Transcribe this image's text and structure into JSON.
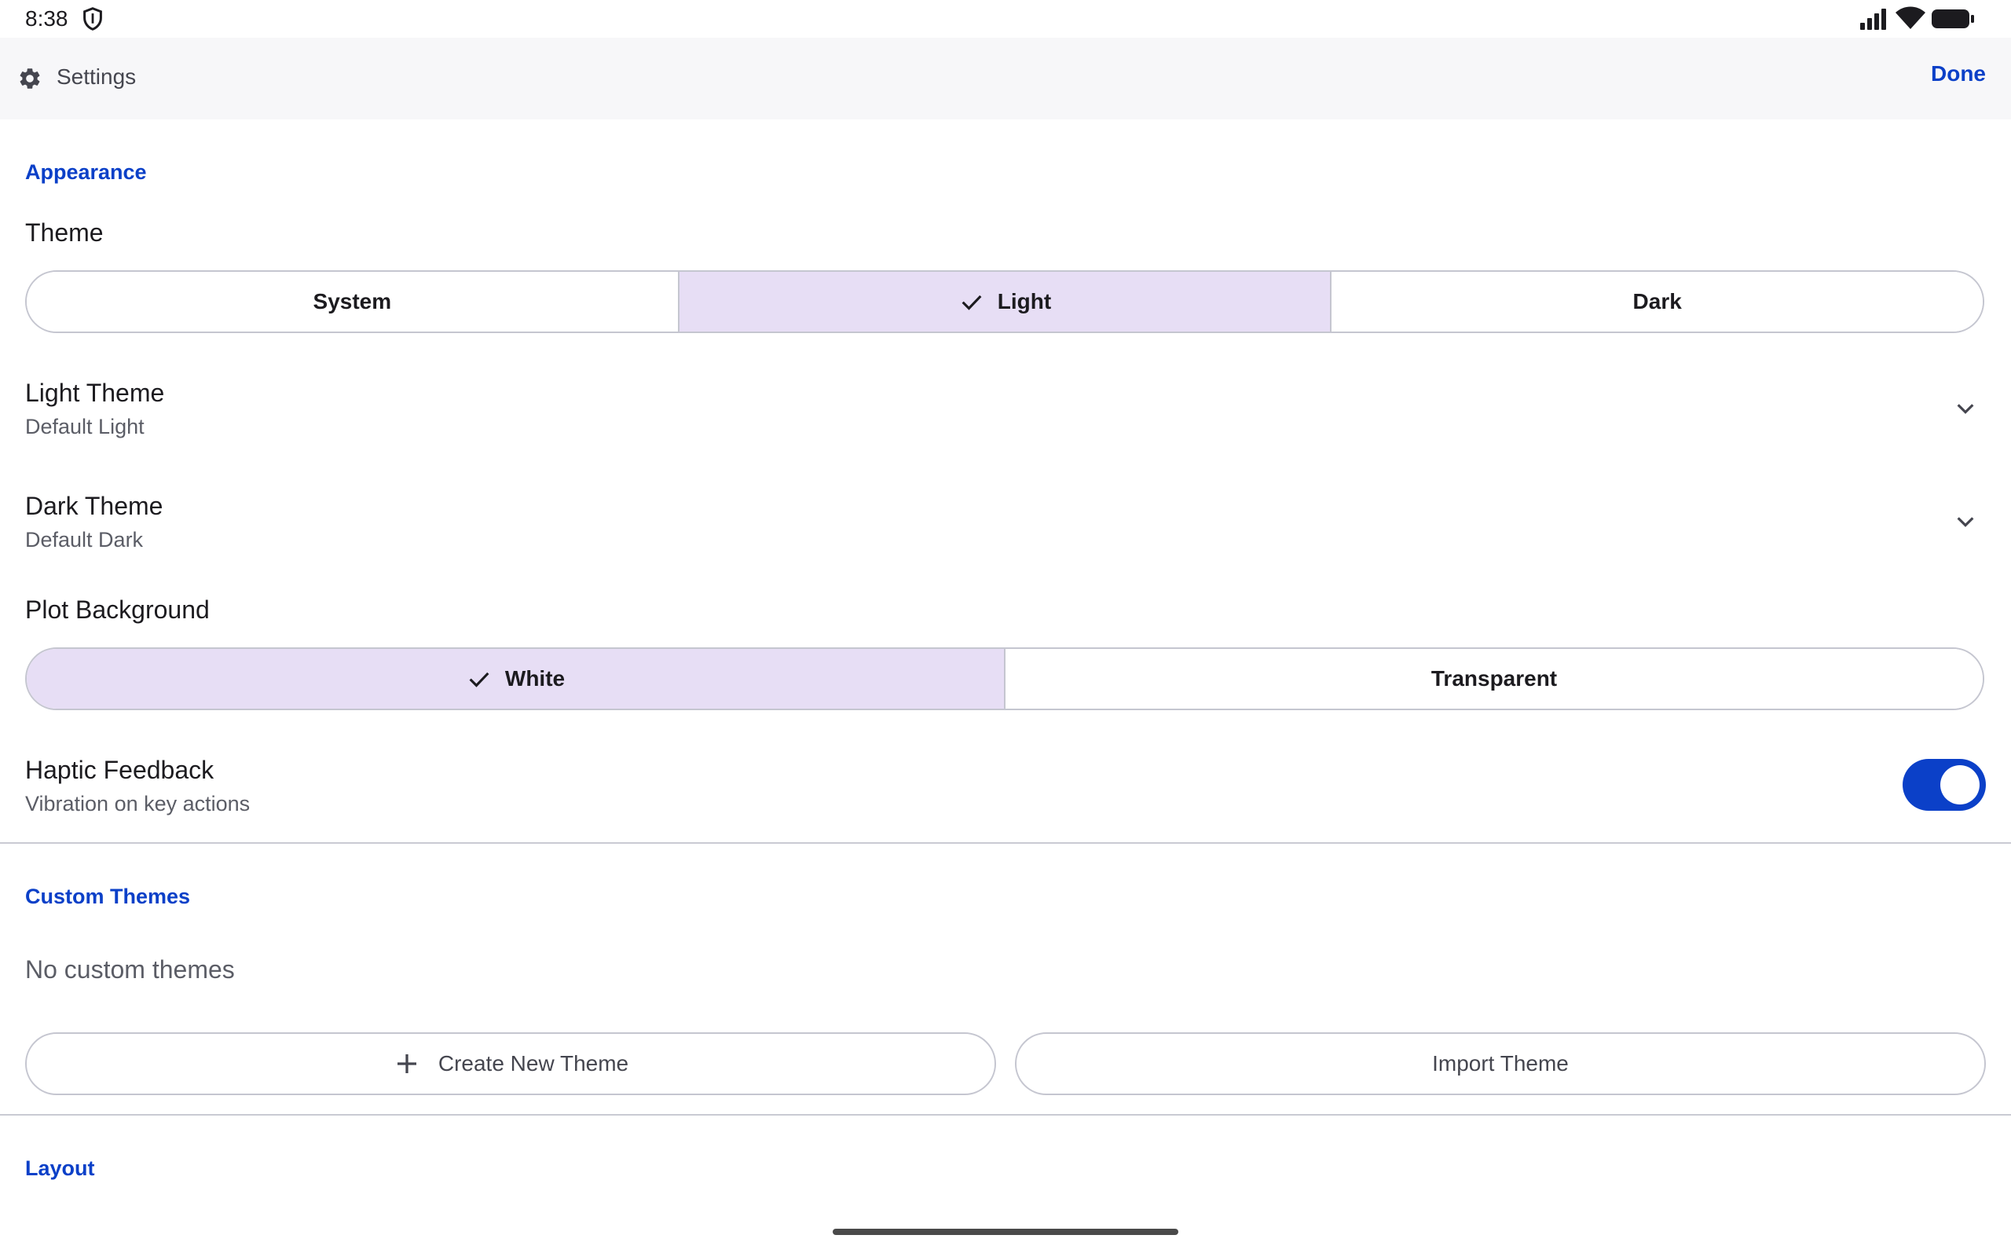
{
  "status_bar": {
    "time": "8:38",
    "icons": [
      "shield-icon",
      "signal-icon",
      "wifi-icon",
      "battery-icon"
    ]
  },
  "app_bar": {
    "title": "Settings",
    "icon": "gear-icon",
    "done_label": "Done"
  },
  "appearance": {
    "section_title": "Appearance",
    "theme": {
      "label": "Theme",
      "options": [
        "System",
        "Light",
        "Dark"
      ],
      "selected": "Light"
    },
    "light_theme": {
      "title": "Light Theme",
      "value": "Default Light"
    },
    "dark_theme": {
      "title": "Dark Theme",
      "value": "Default Dark"
    },
    "plot_background": {
      "label": "Plot Background",
      "options": [
        "White",
        "Transparent"
      ],
      "selected": "White"
    },
    "haptic": {
      "title": "Haptic Feedback",
      "subtitle": "Vibration on key actions",
      "enabled": true
    }
  },
  "custom_themes": {
    "section_title": "Custom Themes",
    "empty_text": "No custom themes",
    "create_label": "Create New Theme",
    "import_label": "Import Theme"
  },
  "layout": {
    "section_title": "Layout"
  },
  "colors": {
    "accent": "#0b40c8",
    "selected_segment": "#e7def5",
    "app_bar_bg": "#f7f7f9",
    "outline": "#c5c6d0"
  }
}
